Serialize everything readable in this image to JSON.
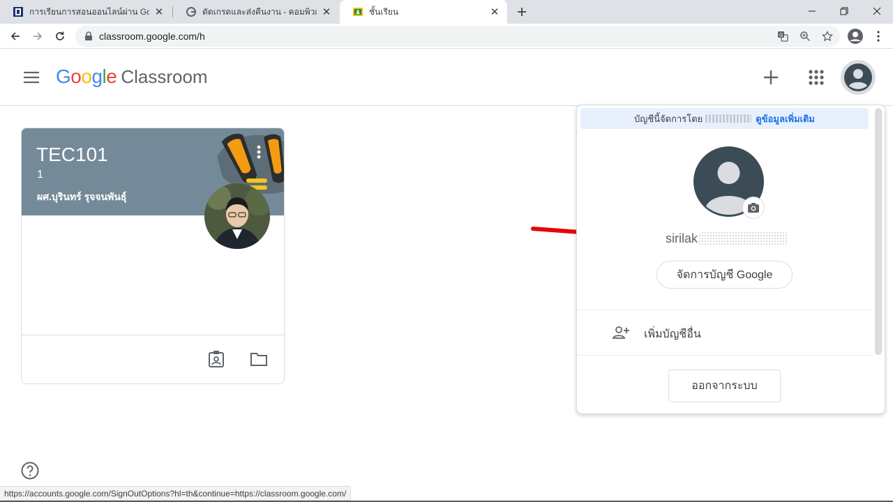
{
  "browser": {
    "tabs": [
      {
        "title": "การเรียนการสอนออนไลน์ผ่าน Google",
        "favicon": "school-emblem-icon",
        "active": false
      },
      {
        "title": "ตัดเกรดและส่งคืนงาน - คอมพิวเตอร์ -",
        "favicon": "google-g-icon",
        "active": false
      },
      {
        "title": "ชั้นเรียน",
        "favicon": "classroom-icon",
        "active": true
      }
    ],
    "url": "classroom.google.com/h",
    "status_url": "https://accounts.google.com/SignOutOptions?hl=th&continue=https://classroom.google.com/"
  },
  "header": {
    "logo_google": [
      "G",
      "o",
      "o",
      "g",
      "l",
      "e"
    ],
    "logo_colors": [
      "#4285f4",
      "#ea4335",
      "#fbbc05",
      "#4285f4",
      "#34a853",
      "#ea4335"
    ],
    "product": "Classroom"
  },
  "class_card": {
    "title": "TEC101",
    "section": "1",
    "teacher": "ผศ.บุรินทร์ รุจจนพันธุ์",
    "banner_color": "#758a99"
  },
  "account_popup": {
    "managed_prefix": "บัญชีนี้จัดการโดย",
    "learn_more": "ดูข้อมูลเพิ่มเติม",
    "account_name": "sirilak",
    "manage_label": "จัดการบัญชี Google",
    "add_account_label": "เพิ่มบัญชีอื่น",
    "sign_out_label": "ออกจากระบบ"
  },
  "colors": {
    "accent": "#1a73e8",
    "annotation": "#e8000b"
  }
}
